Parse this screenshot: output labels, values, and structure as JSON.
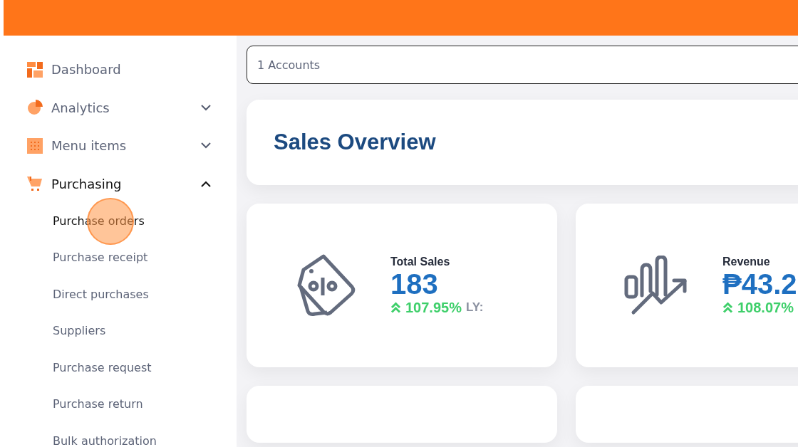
{
  "sidebar": {
    "items": [
      {
        "label": "Dashboard"
      },
      {
        "label": "Analytics",
        "expanded": false
      },
      {
        "label": "Menu items",
        "expanded": false
      },
      {
        "label": "Purchasing",
        "expanded": true,
        "children": [
          {
            "label": "Purchase orders",
            "selected": true
          },
          {
            "label": "Purchase receipt",
            "selected": false
          },
          {
            "label": "Direct purchases",
            "selected": false
          },
          {
            "label": "Suppliers",
            "selected": false
          },
          {
            "label": "Purchase request",
            "selected": false
          },
          {
            "label": "Purchase return",
            "selected": false
          },
          {
            "label": "Bulk authorization",
            "selected": false
          }
        ]
      }
    ]
  },
  "account_field": {
    "value": "1 Accounts"
  },
  "overview": {
    "title": "Sales Overview"
  },
  "stats": [
    {
      "label": "Total Sales",
      "value": "183",
      "change": "107.95%",
      "suffix": "LY:"
    },
    {
      "label": "Revenue",
      "value": "₱43.2",
      "change": "108.07%"
    }
  ]
}
